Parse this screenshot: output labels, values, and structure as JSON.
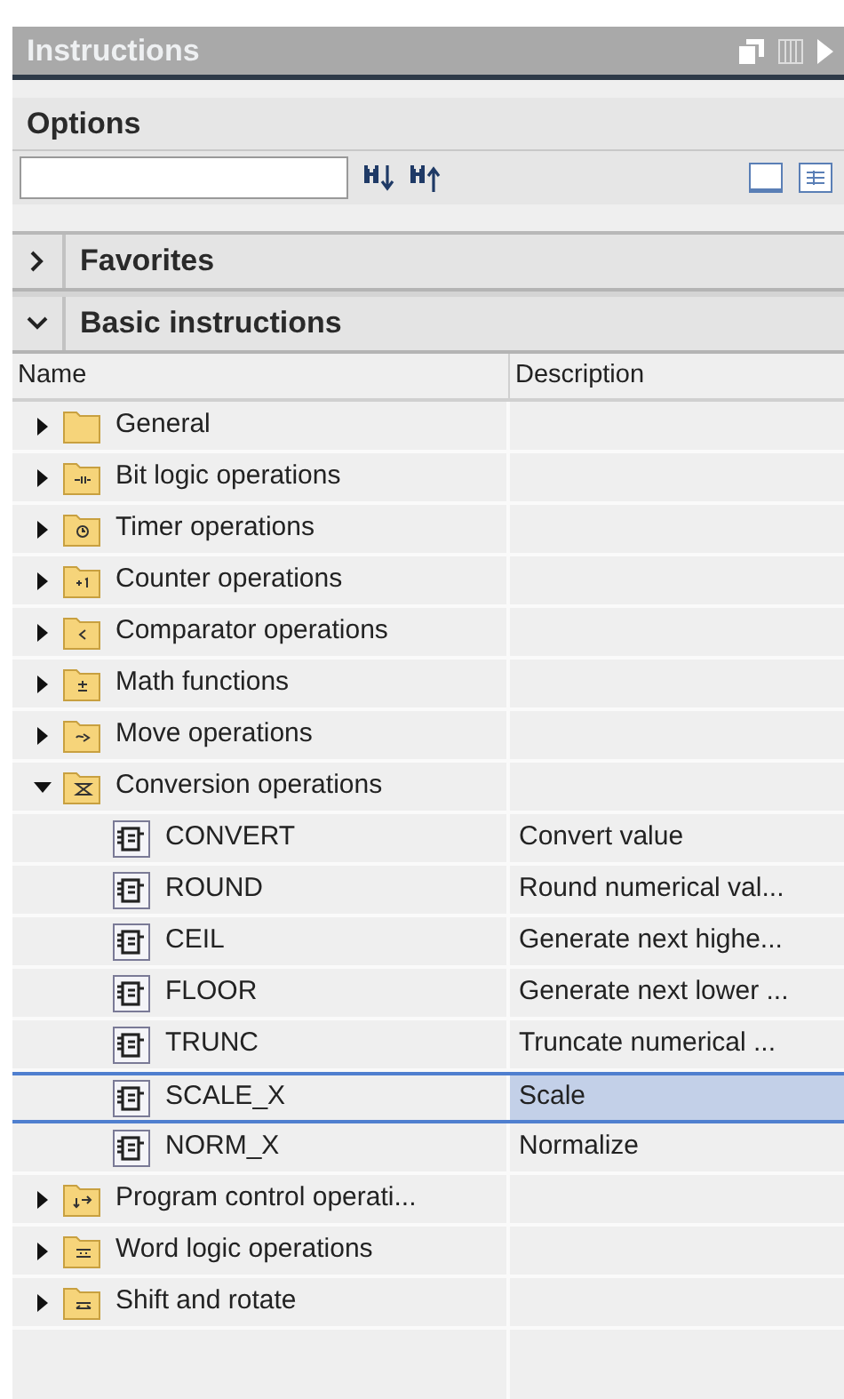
{
  "panel": {
    "title": "Instructions"
  },
  "options": {
    "title": "Options"
  },
  "sections": [
    {
      "title": "Favorites",
      "expanded": false
    },
    {
      "title": "Basic instructions",
      "expanded": true,
      "columns": [
        "Name",
        "Description"
      ],
      "items": [
        {
          "name": "General",
          "kind": "folder",
          "expanded": false,
          "selected": false
        },
        {
          "name": "Bit logic operations",
          "kind": "folder",
          "expanded": false,
          "selected": false
        },
        {
          "name": "Timer operations",
          "kind": "folder",
          "expanded": false,
          "selected": false
        },
        {
          "name": "Counter operations",
          "kind": "folder",
          "expanded": false,
          "selected": false
        },
        {
          "name": "Comparator operations",
          "kind": "folder",
          "expanded": false,
          "selected": false
        },
        {
          "name": "Math functions",
          "kind": "folder",
          "expanded": false,
          "selected": false
        },
        {
          "name": "Move operations",
          "kind": "folder",
          "expanded": false,
          "selected": false
        },
        {
          "name": "Conversion operations",
          "kind": "folder",
          "expanded": true,
          "selected": false,
          "children": [
            {
              "name": "CONVERT",
              "kind": "instruction",
              "description": "Convert value",
              "selected": false
            },
            {
              "name": "ROUND",
              "kind": "instruction",
              "description": "Round numerical val...",
              "selected": false
            },
            {
              "name": "CEIL",
              "kind": "instruction",
              "description": "Generate next highe...",
              "selected": false
            },
            {
              "name": "FLOOR",
              "kind": "instruction",
              "description": "Generate next lower ...",
              "selected": false
            },
            {
              "name": "TRUNC",
              "kind": "instruction",
              "description": "Truncate numerical ...",
              "selected": false
            },
            {
              "name": "SCALE_X",
              "kind": "instruction",
              "description": "Scale",
              "selected": true
            },
            {
              "name": "NORM_X",
              "kind": "instruction",
              "description": "Normalize",
              "selected": false
            }
          ]
        },
        {
          "name": "Program control operati...",
          "kind": "folder",
          "expanded": false,
          "selected": false
        },
        {
          "name": "Word logic operations",
          "kind": "folder",
          "expanded": false,
          "selected": false
        },
        {
          "name": "Shift and rotate",
          "kind": "folder",
          "expanded": false,
          "selected": false
        }
      ]
    }
  ]
}
